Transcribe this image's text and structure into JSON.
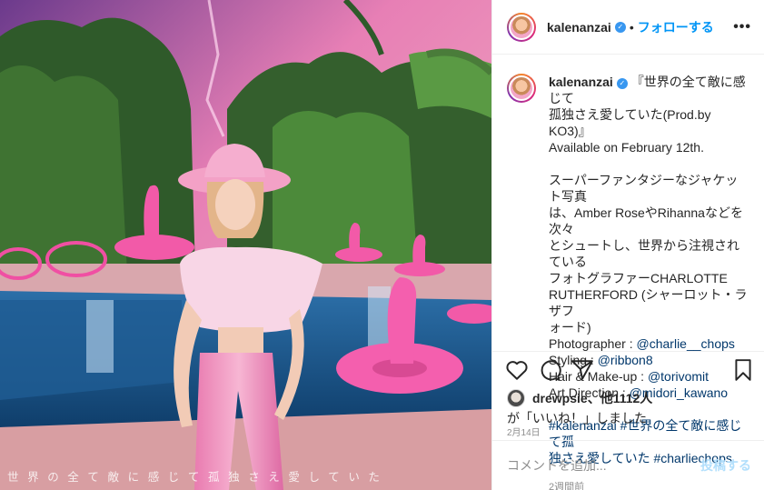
{
  "photo": {
    "overlay_text": "世界の全て敵に感じて孤独さえ愛していた"
  },
  "header": {
    "username": "kalenanzai",
    "separator": "•",
    "follow_label": "フォローする",
    "more_label": "•••"
  },
  "caption": {
    "username": "kalenanzai",
    "title_line1": "『世界の全て敵に感じて",
    "title_line2": "孤独さえ愛していた(Prod.by KO3)』",
    "available": "Available on February 12th.",
    "body_lines": [
      "スーパーファンタジーなジャケット写真",
      "は、Amber RoseやRihannaなどを次々",
      "とシュートし、世界から注視されている",
      "フォトグラファーCHARLOTTE",
      "RUTHERFORD (シャーロット・ラザフ",
      "ォード)"
    ],
    "credits": [
      {
        "label": "Photographer : ",
        "handle": "@charlie__chops"
      },
      {
        "label": "Styling : ",
        "handle": "@ribbon8"
      },
      {
        "label": "Hair & Make-up : ",
        "handle": "@torivomit"
      },
      {
        "label": "Art Direction : ",
        "handle": "@midori_kawano"
      }
    ],
    "hashtags_line1": "#kalenanzai #世界の全て敵に感じて孤",
    "hashtags_line2": "独さえ愛していた #charliechops",
    "time_ago": "2週間前"
  },
  "likes": {
    "liker": "drewpsie",
    "rest": "、他1112人",
    "suffix": "が「いいね！」しました"
  },
  "post_date": "2月14日",
  "comment_box": {
    "placeholder": "コメントを追加...",
    "post_label": "投稿する"
  }
}
